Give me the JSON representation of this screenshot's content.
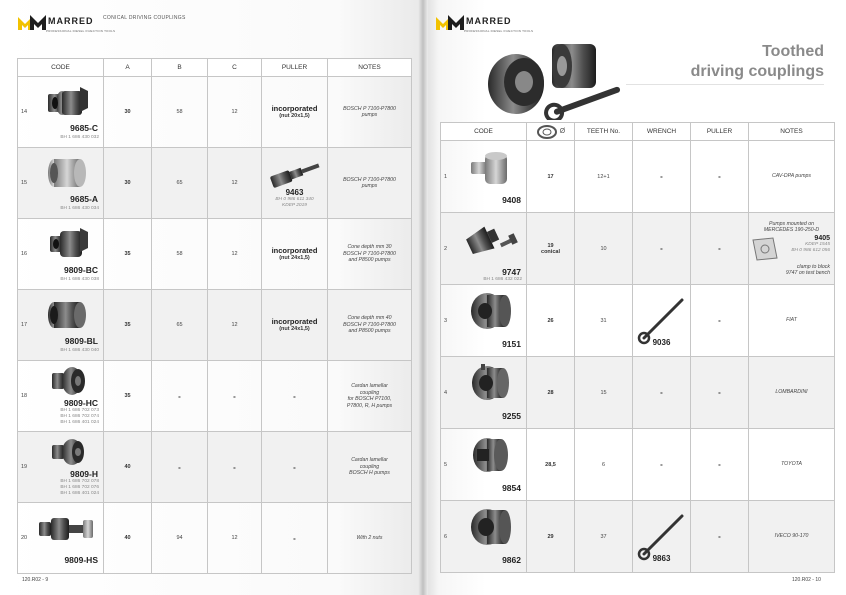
{
  "left_page": {
    "brand": "MARRED",
    "brand_tag": "PROFESSIONAL DIESEL INJECTION TOOLS",
    "section_label": "CONICAL DRIVING COUPLINGS",
    "footer": "120.R02 - 9",
    "headers": {
      "code": "CODE",
      "a": "A",
      "b": "B",
      "c": "C",
      "puller": "PULLER",
      "notes": "NOTES"
    },
    "rows": [
      {
        "idx": "14",
        "code": "9685-C",
        "bh": [
          "BH 1 686 430 032"
        ],
        "a": "30",
        "b": "58",
        "c": "12",
        "puller": {
          "kind": "text",
          "main": "incorporated",
          "sub": "(nut 20x1,5)"
        },
        "notes": [
          "BOSCH P 7100-P7800",
          "pumps"
        ]
      },
      {
        "idx": "15",
        "code": "9685-A",
        "bh": [
          "BH 1 686 430 034"
        ],
        "a": "30",
        "b": "65",
        "c": "12",
        "puller": {
          "kind": "tool",
          "code": "9463",
          "sub": [
            "BH 0 986 611 340",
            "KDEP 2019"
          ]
        },
        "notes": [
          "BOSCH P 7100-P7800",
          "pumps"
        ]
      },
      {
        "idx": "16",
        "code": "9809-BC",
        "bh": [
          "BH 1 686 430 038"
        ],
        "a": "35",
        "b": "58",
        "c": "12",
        "puller": {
          "kind": "text",
          "main": "incorporated",
          "sub": "(nut 24x1,5)"
        },
        "notes": [
          "Cone depth mm 30",
          "BOSCH P 7100-P7800",
          "and P8500 pumps"
        ]
      },
      {
        "idx": "17",
        "code": "9809-BL",
        "bh": [
          "BH 1 686 430 040"
        ],
        "a": "35",
        "b": "65",
        "c": "12",
        "puller": {
          "kind": "text",
          "main": "incorporated",
          "sub": "(nut 24x1,5)"
        },
        "notes": [
          "Cone depth mm 40",
          "BOSCH P 7100-P7800",
          "and P8500 pumps"
        ]
      },
      {
        "idx": "18",
        "code": "9809-HC",
        "bh": [
          "BH 1 686 702 073",
          "BH 1 686 702 074",
          "BH 1 686 401 024"
        ],
        "a": "35",
        "b": "-",
        "c": "-",
        "puller": {
          "kind": "dash",
          "main": "-"
        },
        "notes": [
          "Cardan lamellar",
          "coupling",
          "for BOSCH P7100,",
          "P7800, R, H pumps"
        ]
      },
      {
        "idx": "19",
        "code": "9809-H",
        "bh": [
          "BH 1 686 702 078",
          "BH 1 686 702 076",
          "BH 1 686 401 024"
        ],
        "a": "40",
        "b": "-",
        "c": "-",
        "puller": {
          "kind": "dash",
          "main": "-"
        },
        "notes": [
          "Cardan lamellar",
          "coupling",
          "BOSCH H pumps"
        ]
      },
      {
        "idx": "20",
        "code": "9809-HS",
        "bh": [],
        "a": "40",
        "b": "94",
        "c": "12",
        "puller": {
          "kind": "dash",
          "main": "-"
        },
        "notes": [
          "With 2 nuts"
        ]
      }
    ]
  },
  "right_page": {
    "brand": "MARRED",
    "brand_tag": "PROFESSIONAL DIESEL INJECTION TOOLS",
    "title_line1": "Toothed",
    "title_line2": "driving couplings",
    "footer": "120.R02 - 10",
    "headers": {
      "code": "CODE",
      "diameter_symbol": "Ø",
      "teeth": "TEETH No.",
      "wrench": "WRENCH",
      "puller": "PULLER",
      "notes": "NOTES"
    },
    "rows": [
      {
        "idx": "1",
        "code": "9408",
        "bh": [],
        "diam": [
          "17"
        ],
        "teeth": "12+1",
        "wrench": {
          "kind": "dash",
          "main": "-"
        },
        "puller": "-",
        "notes": {
          "kind": "text",
          "lines": [
            "CAV-DPA pumps"
          ]
        }
      },
      {
        "idx": "2",
        "code": "9747",
        "bh": [
          "BH 1 686 432 022"
        ],
        "diam": [
          "19",
          "conical"
        ],
        "teeth": "10",
        "wrench": {
          "kind": "dash",
          "main": "-"
        },
        "puller": "-",
        "notes": {
          "kind": "tool",
          "top": [
            "Pumps mounted on",
            "MERCEDES 190-250-D"
          ],
          "code": "9405",
          "sub": [
            "KDEP 1545",
            "BH 0 986 612 056"
          ],
          "bottom": [
            "clamp to block",
            "9747 on test bench"
          ]
        }
      },
      {
        "idx": "3",
        "code": "9151",
        "bh": [],
        "diam": [
          "26"
        ],
        "teeth": "31",
        "wrench": {
          "kind": "tool",
          "code": "9036"
        },
        "puller": "-",
        "notes": {
          "kind": "text",
          "lines": [
            "FIAT"
          ]
        }
      },
      {
        "idx": "4",
        "code": "9255",
        "bh": [],
        "diam": [
          "28"
        ],
        "teeth": "15",
        "wrench": {
          "kind": "dash",
          "main": "-"
        },
        "puller": "-",
        "notes": {
          "kind": "text",
          "lines": [
            "LOMBARDINI"
          ]
        }
      },
      {
        "idx": "5",
        "code": "9854",
        "bh": [],
        "diam": [
          "28,5"
        ],
        "teeth": "6",
        "wrench": {
          "kind": "dash",
          "main": "-"
        },
        "puller": "-",
        "notes": {
          "kind": "text",
          "lines": [
            "TOYOTA"
          ]
        }
      },
      {
        "idx": "6",
        "code": "9862",
        "bh": [],
        "diam": [
          "29"
        ],
        "teeth": "37",
        "wrench": {
          "kind": "tool",
          "code": "9863"
        },
        "puller": "-",
        "notes": {
          "kind": "text",
          "lines": [
            "IVECO 90-170"
          ]
        }
      }
    ]
  }
}
